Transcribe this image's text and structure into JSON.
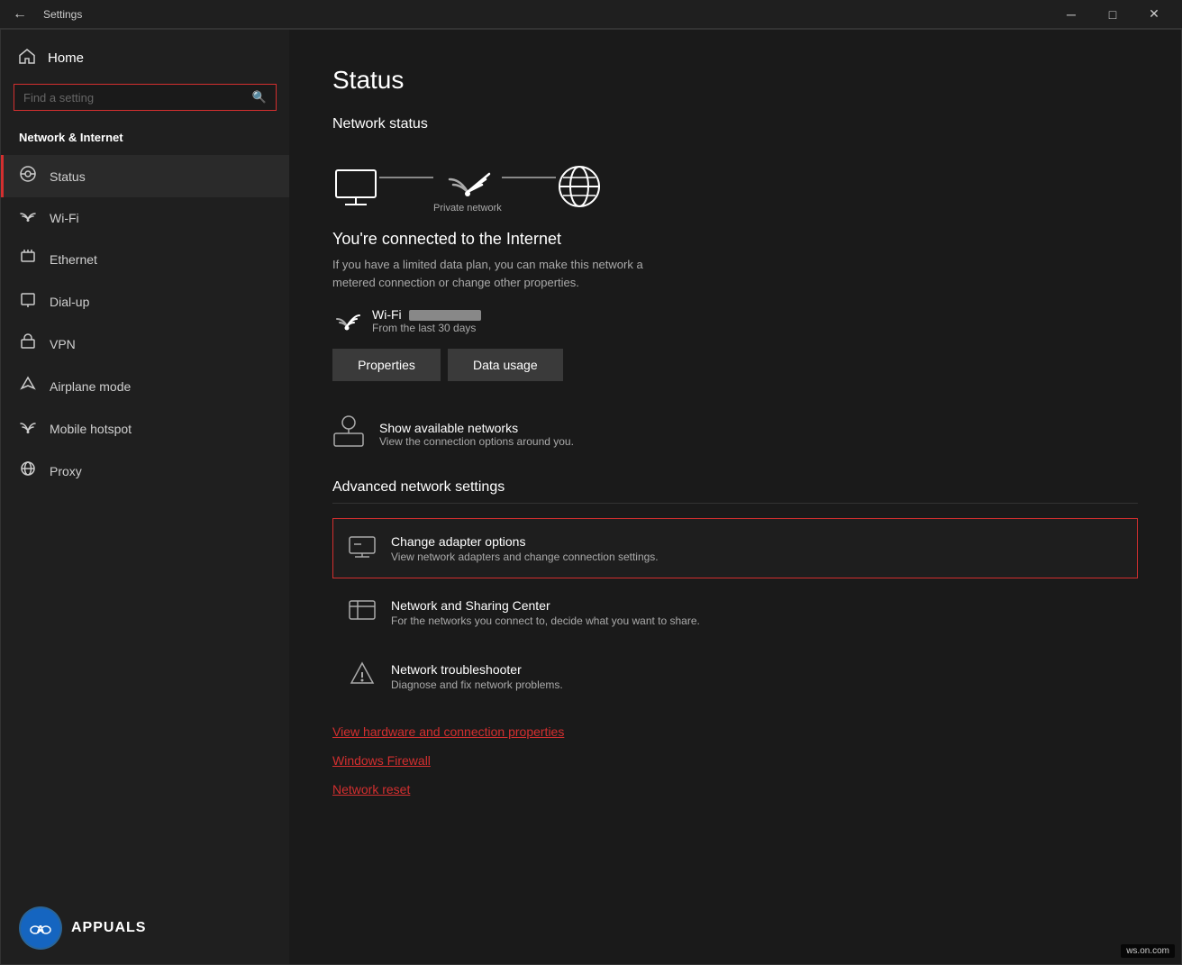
{
  "titlebar": {
    "title": "Settings",
    "minimize": "─",
    "maximize": "□",
    "close": "✕"
  },
  "sidebar": {
    "home_label": "Home",
    "search_placeholder": "Find a setting",
    "section_title": "Network & Internet",
    "items": [
      {
        "id": "status",
        "label": "Status",
        "icon": "🌐",
        "active": true
      },
      {
        "id": "wifi",
        "label": "Wi-Fi",
        "icon": "📶"
      },
      {
        "id": "ethernet",
        "label": "Ethernet",
        "icon": "🔌"
      },
      {
        "id": "dialup",
        "label": "Dial-up",
        "icon": "📞"
      },
      {
        "id": "vpn",
        "label": "VPN",
        "icon": "🔒"
      },
      {
        "id": "airplane",
        "label": "Airplane mode",
        "icon": "✈"
      },
      {
        "id": "hotspot",
        "label": "Mobile hotspot",
        "icon": "📡"
      },
      {
        "id": "proxy",
        "label": "Proxy",
        "icon": "🌐"
      }
    ]
  },
  "main": {
    "page_title": "Status",
    "network_status_title": "Network status",
    "network_label": "Private network",
    "connected_title": "You're connected to the Internet",
    "connected_sub": "If you have a limited data plan, you can make this network a\nmetered connection or change other properties.",
    "wifi_name": "Wi-Fi",
    "wifi_period": "From the last 30 days",
    "btn_properties": "Properties",
    "btn_data_usage": "Data usage",
    "show_networks_title": "Show available networks",
    "show_networks_sub": "View the connection options around you.",
    "advanced_title": "Advanced network settings",
    "adv_items": [
      {
        "id": "change-adapter",
        "title": "Change adapter options",
        "sub": "View network adapters and change connection settings.",
        "highlighted": true
      },
      {
        "id": "sharing-center",
        "title": "Network and Sharing Center",
        "sub": "For the networks you connect to, decide what you want to share.",
        "highlighted": false
      },
      {
        "id": "troubleshooter",
        "title": "Network troubleshooter",
        "sub": "Diagnose and fix network problems.",
        "highlighted": false
      }
    ],
    "links": [
      "View hardware and connection properties",
      "Windows Firewall",
      "Network reset"
    ]
  },
  "watermark": "ws.on.com"
}
